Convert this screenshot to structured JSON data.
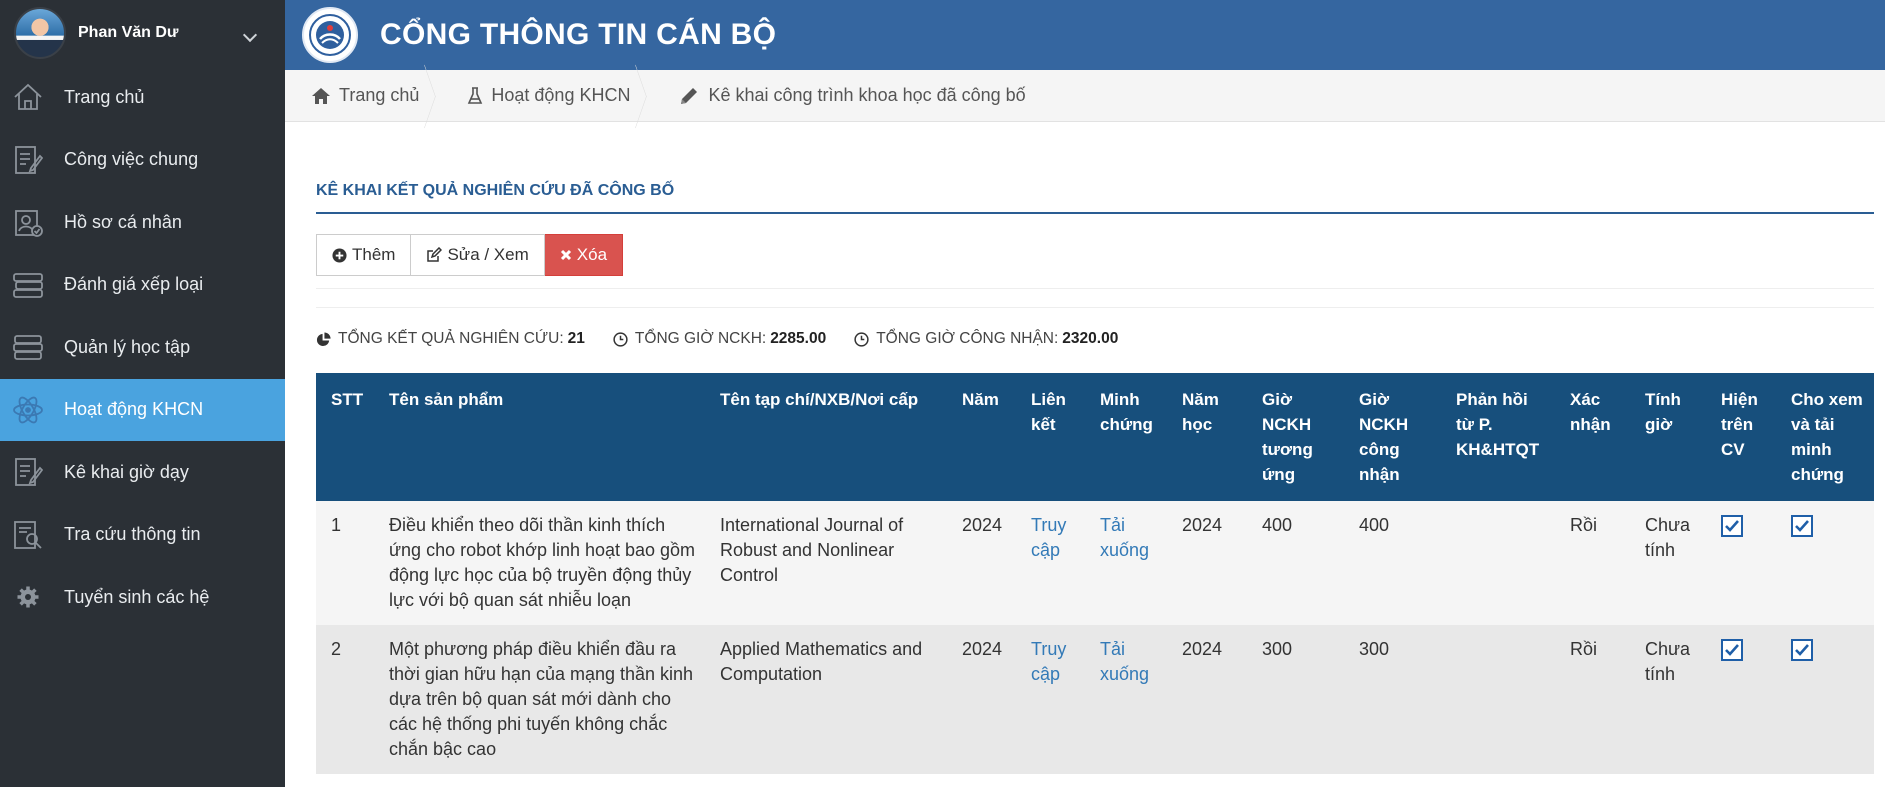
{
  "user": {
    "name": "Phan Văn Dư"
  },
  "header": {
    "title": "CỔNG THÔNG TIN CÁN BỘ"
  },
  "sidebar": {
    "items": [
      {
        "label": "Trang chủ",
        "icon": "home-icon"
      },
      {
        "label": "Công việc chung",
        "icon": "document-edit-icon"
      },
      {
        "label": "Hồ sơ cá nhân",
        "icon": "profile-icon"
      },
      {
        "label": "Đánh giá xếp loại",
        "icon": "books-icon"
      },
      {
        "label": "Quản lý học tập",
        "icon": "books-stack-icon"
      },
      {
        "label": "Hoạt động KHCN",
        "icon": "atom-icon",
        "active": true
      },
      {
        "label": "Kê khai giờ dạy",
        "icon": "document-pen-icon"
      },
      {
        "label": "Tra cứu thông tin",
        "icon": "search-doc-icon"
      },
      {
        "label": "Tuyển sinh các hệ",
        "icon": "gear-icon"
      }
    ]
  },
  "breadcrumb": {
    "items": [
      {
        "label": "Trang chủ",
        "icon": "home-icon"
      },
      {
        "label": "Hoạt động KHCN",
        "icon": "flask-icon"
      },
      {
        "label": "Kê khai công trình khoa học đã công bố",
        "icon": "pencil-icon"
      }
    ]
  },
  "main": {
    "section_title": "Kê khai kết quả nghiên cứu đã công bố",
    "toolbar": {
      "add_label": "Thêm",
      "edit_label": "Sửa / Xem",
      "delete_label": "Xóa"
    },
    "stats": {
      "total_results_label": "Tổng kết quả nghiên cứu:",
      "total_results_value": "21",
      "total_hours_label": "Tổng giờ NCKH:",
      "total_hours_value": "2285.00",
      "recognized_hours_label": "Tổng giờ công nhận:",
      "recognized_hours_value": "2320.00"
    },
    "table": {
      "headers": {
        "stt": "STT",
        "product": "Tên sản phẩm",
        "journal": "Tên tạp chí/NXB/Nơi cấp",
        "year": "Năm",
        "link": "Liên kết",
        "evidence": "Minh chứng",
        "school_year": "Năm học",
        "hours": "Giờ NCKH tương ứng",
        "approved_hours": "Giờ NCKH công nhận",
        "feedback": "Phản hồi từ P. KH&HTQT",
        "confirm": "Xác nhận",
        "count_hours": "Tính giờ",
        "show_cv": "Hiện trên CV",
        "share": "Cho xem và tải minh chứng"
      },
      "rows": [
        {
          "stt": "1",
          "product": "Điều khiển theo dõi thần kinh thích ứng cho robot khớp linh hoạt bao gồm động lực học của bộ truyền động thủy lực với bộ quan sát nhiễu loạn",
          "journal": "International Journal of Robust and Nonlinear Control",
          "year": "2024",
          "link": "Truy cập",
          "evidence": "Tải xuống",
          "school_year": "2024",
          "hours": "400",
          "approved_hours": "400",
          "feedback": "",
          "confirm": "Rồi",
          "count_hours": "Chưa tính",
          "show_cv": true,
          "share": true
        },
        {
          "stt": "2",
          "product": "Một phương pháp điều khiển đầu ra thời gian hữu hạn của mạng thần kinh dựa trên bộ quan sát mới dành cho các hệ thống phi tuyến không chắc chắn bậc cao",
          "journal": "Applied Mathematics and Computation",
          "year": "2024",
          "link": "Truy cập",
          "evidence": "Tải xuống",
          "school_year": "2024",
          "hours": "300",
          "approved_hours": "300",
          "feedback": "",
          "confirm": "Rồi",
          "count_hours": "Chưa tính",
          "show_cv": true,
          "share": true
        }
      ]
    }
  },
  "colors": {
    "sidebar_bg": "#2b3036",
    "active_nav": "#4aa3df",
    "header_bg": "#3566a0",
    "table_header_bg": "#174f7c",
    "danger": "#d9534f",
    "link": "#337ab7"
  }
}
